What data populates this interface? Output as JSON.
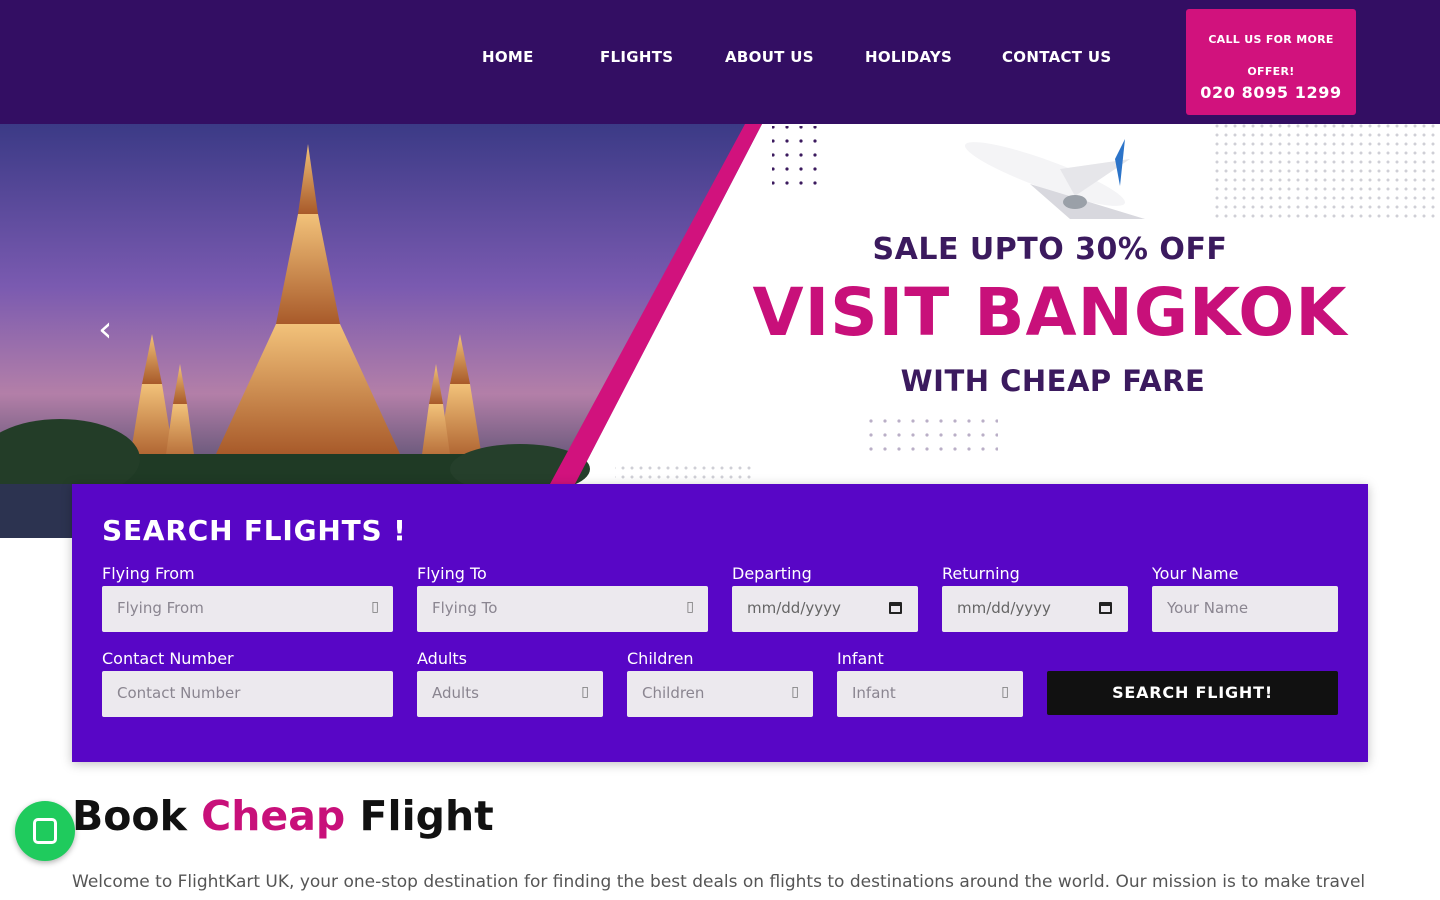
{
  "nav": {
    "items": [
      {
        "label": "HOME"
      },
      {
        "label": "FLIGHTS"
      },
      {
        "label": "ABOUT US"
      },
      {
        "label": "HOLIDAYS"
      },
      {
        "label": "CONTACT US"
      }
    ],
    "cta_line1": "CALL US FOR MORE",
    "cta_line2": "OFFER!",
    "cta_phone": "020 8095 1299"
  },
  "hero": {
    "sale": "SALE UPTO 30% OFF",
    "headline": "VISIT BANGKOK",
    "tagline": "WITH CHEAP FARE",
    "prev_icon": "‹",
    "next_icon": "›"
  },
  "search": {
    "title": "SEARCH FLIGHTS !",
    "fields": {
      "from": {
        "label": "Flying From",
        "placeholder": "Flying From",
        "icon": "map-marker-icon"
      },
      "to": {
        "label": "Flying To",
        "placeholder": "Flying To",
        "icon": "map-marker-icon"
      },
      "departing": {
        "label": "Departing",
        "placeholder": "mm/dd/yyyy"
      },
      "returning": {
        "label": "Returning",
        "placeholder": "mm/dd/yyyy"
      },
      "name": {
        "label": "Your Name",
        "placeholder": "Your Name"
      },
      "contact": {
        "label": "Contact Number",
        "placeholder": "Contact Number"
      },
      "adults": {
        "label": "Adults",
        "placeholder": "Adults",
        "icon": "user-icon"
      },
      "children": {
        "label": "Children",
        "placeholder": "Children",
        "icon": "user-icon"
      },
      "infant": {
        "label": "Infant",
        "placeholder": "Infant",
        "icon": "user-icon"
      }
    },
    "button": "SEARCH FLIGHT!"
  },
  "intro": {
    "title_1": "Book",
    "title_2": "Cheap",
    "title_3": "Flight",
    "text": "Welcome to FlightKart UK, your one-stop destination for finding the best deals on flights to destinations around the world. Our mission is to make travel"
  },
  "colors": {
    "header_bg": "#330e63",
    "accent": "#c8107a",
    "panel_bg": "#5806c6",
    "whatsapp": "#1fcb5d"
  }
}
